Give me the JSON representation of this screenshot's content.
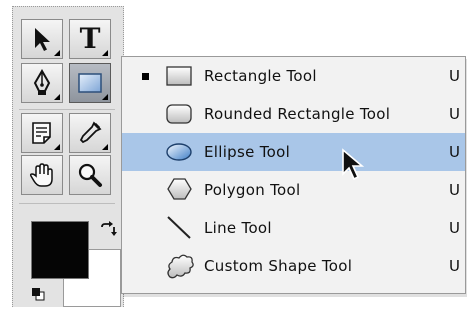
{
  "toolbox": {
    "tools": [
      {
        "name": "move-tool",
        "icon": "arrow-cursor-icon"
      },
      {
        "name": "type-tool",
        "icon": "type-icon",
        "glyph": "T"
      },
      {
        "name": "pen-tool",
        "icon": "pen-nib-icon"
      },
      {
        "name": "rectangle-tool",
        "icon": "rectangle-icon",
        "active": true
      },
      {
        "name": "notes-tool",
        "icon": "notes-icon"
      },
      {
        "name": "eyedropper-tool",
        "icon": "eyedropper-icon"
      },
      {
        "name": "hand-tool",
        "icon": "hand-icon"
      },
      {
        "name": "zoom-tool",
        "icon": "magnifier-icon"
      }
    ],
    "foreground_color": "#050505",
    "background_color": "#ffffff"
  },
  "flyout": {
    "items": [
      {
        "label": "Rectangle Tool",
        "shortcut": "U",
        "selected": true,
        "icon": "rectangle-icon"
      },
      {
        "label": "Rounded Rectangle Tool",
        "shortcut": "U",
        "selected": false,
        "icon": "rounded-rectangle-icon"
      },
      {
        "label": "Ellipse Tool",
        "shortcut": "U",
        "selected": false,
        "highlighted": true,
        "icon": "ellipse-icon"
      },
      {
        "label": "Polygon Tool",
        "shortcut": "U",
        "selected": false,
        "icon": "polygon-icon"
      },
      {
        "label": "Line Tool",
        "shortcut": "U",
        "selected": false,
        "icon": "line-icon"
      },
      {
        "label": "Custom Shape Tool",
        "shortcut": "U",
        "selected": false,
        "icon": "custom-shape-icon"
      }
    ],
    "highlight_color": "#a9c6e8"
  }
}
